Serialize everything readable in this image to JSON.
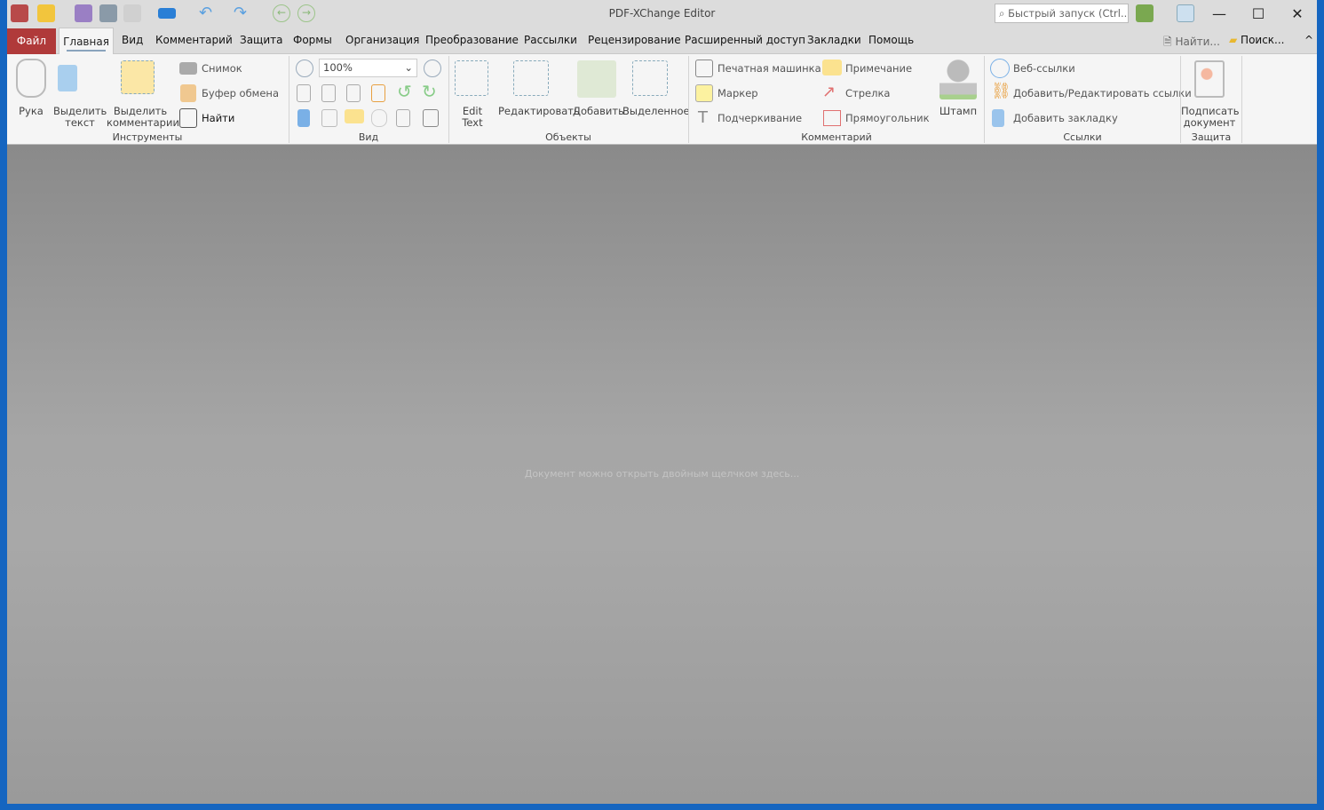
{
  "window": {
    "title": "PDF-XChange Editor",
    "minimize": "—",
    "maximize": "☐",
    "close": "✕"
  },
  "quick_launch": {
    "placeholder": "Быстрый запуск (Ctrl..."
  },
  "menu": {
    "file": "Файл",
    "tabs": [
      "Главная",
      "Вид",
      "Комментарий",
      "Защита",
      "Формы",
      "Организация",
      "Преобразование",
      "Рассылки",
      "Рецензирование",
      "Расширенный доступ",
      "Закладки",
      "Помощь"
    ],
    "find": "Найти...",
    "search": "Поиск...",
    "collapse": "^"
  },
  "ribbon": {
    "tools": {
      "hand": "Рука",
      "select_text": "Выделить\nтекст",
      "select_comments": "Выделить\nкомментарии",
      "snapshot": "Снимок",
      "clipboard": "Буфер обмена",
      "find": "Найти",
      "group": "Инструменты"
    },
    "view": {
      "zoom": "100%",
      "group": "Вид"
    },
    "objects": {
      "edit_text": "Edit\nText",
      "edit": "Редактировать",
      "add": "Добавить",
      "selected": "Выделенное",
      "group": "Объекты"
    },
    "comments": {
      "typewriter": "Печатная машинка",
      "note": "Примечание",
      "marker": "Маркер",
      "arrow": "Стрелка",
      "underline": "Подчеркивание",
      "rectangle": "Прямоугольник",
      "stamp": "Штамп",
      "group": "Комментарий"
    },
    "links": {
      "web_links": "Веб-ссылки",
      "add_edit_links": "Добавить/Редактировать ссылки",
      "add_bookmark": "Добавить закладку",
      "group": "Ссылки"
    },
    "protect": {
      "sign": "Подписать\nдокумент",
      "group": "Защита"
    }
  },
  "document": {
    "hint": "Документ можно открыть двойным щелчком здесь..."
  },
  "colors": {
    "file_tab": "#b03a3a",
    "chrome": "#dcdcdc",
    "ribbon": "#f5f5f5",
    "workspace": "#a6a6a6",
    "desktop": "#1565c0"
  }
}
